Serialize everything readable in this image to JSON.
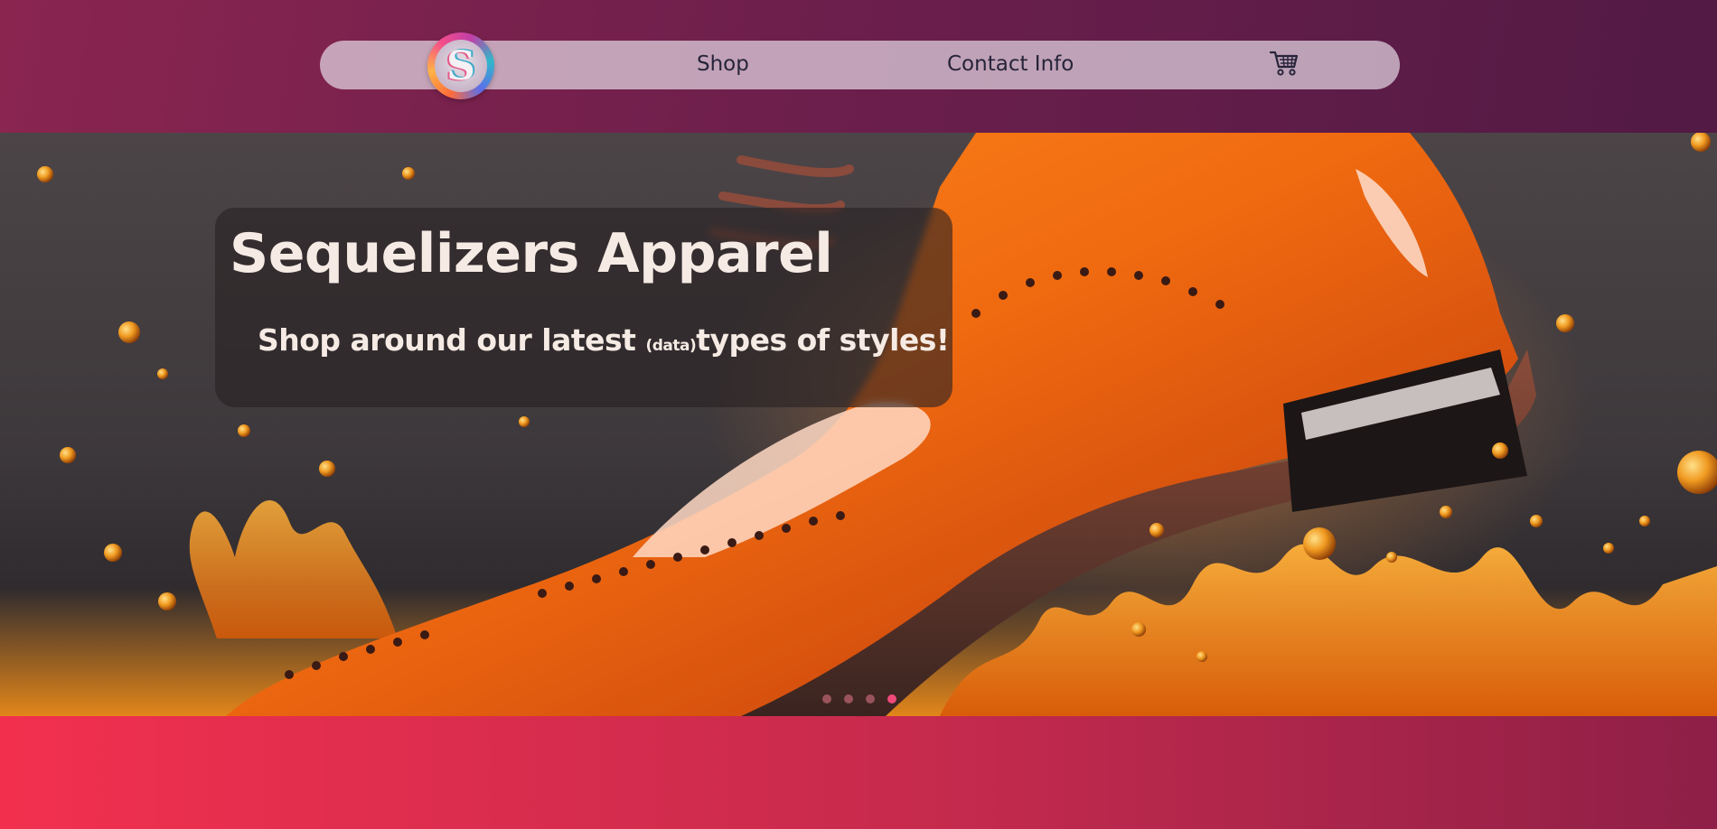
{
  "header": {
    "logo_letter": "S",
    "nav": {
      "shop": "Shop",
      "contact": "Contact Info"
    },
    "cart_icon": "cart-icon"
  },
  "hero": {
    "title": "Sequelizers Apparel",
    "subtitle_before": "Shop around our latest ",
    "subtitle_small": "(data)",
    "subtitle_after": "types of styles!",
    "carousel": {
      "count": 4,
      "active_index": 4
    }
  },
  "colors": {
    "header_start": "#8a2550",
    "header_end": "#521a45",
    "band_start": "#f2304e",
    "band_end": "#8e1f47",
    "text_light": "#f6ebe4",
    "nav_text": "#27243a"
  }
}
